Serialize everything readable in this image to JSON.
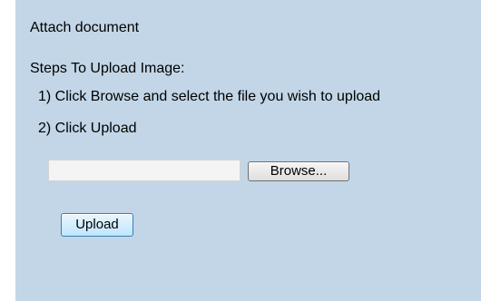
{
  "form": {
    "title": "Attach document",
    "steps_heading": "Steps To Upload Image:",
    "steps": [
      "1) Click Browse and select the file you wish to upload",
      "2) Click Upload"
    ],
    "file_input_value": "",
    "browse_label": "Browse...",
    "upload_label": "Upload"
  }
}
